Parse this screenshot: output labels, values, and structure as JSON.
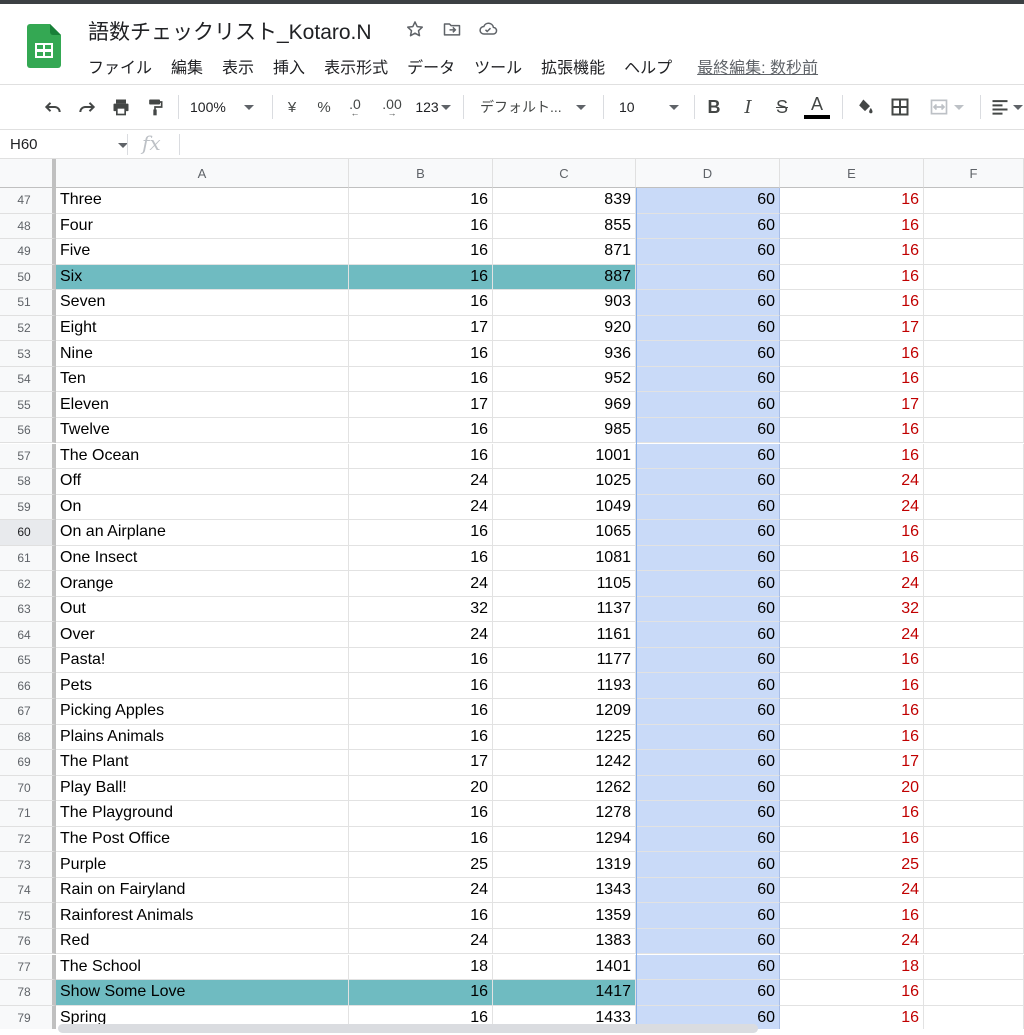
{
  "app": {
    "doc_title": "語数チェックリスト_Kotaro.N",
    "title_icons": [
      "star-icon",
      "move-to-folder-icon",
      "cloud-saved-icon"
    ]
  },
  "menu": {
    "items": [
      "ファイル",
      "編集",
      "表示",
      "挿入",
      "表示形式",
      "データ",
      "ツール",
      "拡張機能",
      "ヘルプ"
    ],
    "last_edit": "最終編集: 数秒前"
  },
  "toolbar": {
    "zoom": "100%",
    "currency": "¥",
    "percent": "%",
    "decimal_decrease": ".0",
    "decimal_increase": ".00",
    "number_format": "123",
    "font": "デフォルト...",
    "font_size": "10",
    "bold": "B",
    "italic": "I",
    "strikethrough": "S",
    "text_color": "A"
  },
  "formula_bar": {
    "name_box": "H60",
    "fx": "fx",
    "value": ""
  },
  "columns": [
    "A",
    "B",
    "C",
    "D",
    "E",
    "F"
  ],
  "selected_row": 60,
  "highlight_color": "#6fbbc1",
  "column_d_color": "#c9daf8",
  "column_e_text_color": "#c00000",
  "rows": [
    {
      "n": 47,
      "a": "Three",
      "b": "16",
      "c": "839",
      "d": "60",
      "e": "16"
    },
    {
      "n": 48,
      "a": "Four",
      "b": "16",
      "c": "855",
      "d": "60",
      "e": "16"
    },
    {
      "n": 49,
      "a": "Five",
      "b": "16",
      "c": "871",
      "d": "60",
      "e": "16"
    },
    {
      "n": 50,
      "a": "Six",
      "b": "16",
      "c": "887",
      "d": "60",
      "e": "16",
      "hl": true
    },
    {
      "n": 51,
      "a": "Seven",
      "b": "16",
      "c": "903",
      "d": "60",
      "e": "16"
    },
    {
      "n": 52,
      "a": "Eight",
      "b": "17",
      "c": "920",
      "d": "60",
      "e": "17"
    },
    {
      "n": 53,
      "a": "Nine",
      "b": "16",
      "c": "936",
      "d": "60",
      "e": "16"
    },
    {
      "n": 54,
      "a": "Ten",
      "b": "16",
      "c": "952",
      "d": "60",
      "e": "16"
    },
    {
      "n": 55,
      "a": "Eleven",
      "b": "17",
      "c": "969",
      "d": "60",
      "e": "17"
    },
    {
      "n": 56,
      "a": "Twelve",
      "b": "16",
      "c": "985",
      "d": "60",
      "e": "16"
    },
    {
      "n": 57,
      "a": "The Ocean",
      "b": "16",
      "c": "1001",
      "d": "60",
      "e": "16"
    },
    {
      "n": 58,
      "a": "Off",
      "b": "24",
      "c": "1025",
      "d": "60",
      "e": "24"
    },
    {
      "n": 59,
      "a": "On",
      "b": "24",
      "c": "1049",
      "d": "60",
      "e": "24"
    },
    {
      "n": 60,
      "a": "On an Airplane",
      "b": "16",
      "c": "1065",
      "d": "60",
      "e": "16"
    },
    {
      "n": 61,
      "a": "One Insect",
      "b": "16",
      "c": "1081",
      "d": "60",
      "e": "16"
    },
    {
      "n": 62,
      "a": "Orange",
      "b": "24",
      "c": "1105",
      "d": "60",
      "e": "24"
    },
    {
      "n": 63,
      "a": "Out",
      "b": "32",
      "c": "1137",
      "d": "60",
      "e": "32"
    },
    {
      "n": 64,
      "a": "Over",
      "b": "24",
      "c": "1161",
      "d": "60",
      "e": "24"
    },
    {
      "n": 65,
      "a": "Pasta!",
      "b": "16",
      "c": "1177",
      "d": "60",
      "e": "16"
    },
    {
      "n": 66,
      "a": "Pets",
      "b": "16",
      "c": "1193",
      "d": "60",
      "e": "16"
    },
    {
      "n": 67,
      "a": "Picking Apples",
      "b": "16",
      "c": "1209",
      "d": "60",
      "e": "16"
    },
    {
      "n": 68,
      "a": "Plains Animals",
      "b": "16",
      "c": "1225",
      "d": "60",
      "e": "16"
    },
    {
      "n": 69,
      "a": "The Plant",
      "b": "17",
      "c": "1242",
      "d": "60",
      "e": "17"
    },
    {
      "n": 70,
      "a": "Play Ball!",
      "b": "20",
      "c": "1262",
      "d": "60",
      "e": "20"
    },
    {
      "n": 71,
      "a": "The Playground",
      "b": "16",
      "c": "1278",
      "d": "60",
      "e": "16"
    },
    {
      "n": 72,
      "a": "The Post Office",
      "b": "16",
      "c": "1294",
      "d": "60",
      "e": "16"
    },
    {
      "n": 73,
      "a": "Purple",
      "b": "25",
      "c": "1319",
      "d": "60",
      "e": "25"
    },
    {
      "n": 74,
      "a": "Rain on Fairyland",
      "b": "24",
      "c": "1343",
      "d": "60",
      "e": "24"
    },
    {
      "n": 75,
      "a": "Rainforest Animals",
      "b": "16",
      "c": "1359",
      "d": "60",
      "e": "16"
    },
    {
      "n": 76,
      "a": "Red",
      "b": "24",
      "c": "1383",
      "d": "60",
      "e": "24"
    },
    {
      "n": 77,
      "a": "The School",
      "b": "18",
      "c": "1401",
      "d": "60",
      "e": "18"
    },
    {
      "n": 78,
      "a": "Show Some Love",
      "b": "16",
      "c": "1417",
      "d": "60",
      "e": "16",
      "hl": true
    },
    {
      "n": 79,
      "a": "Spring",
      "b": "16",
      "c": "1433",
      "d": "60",
      "e": "16"
    }
  ]
}
